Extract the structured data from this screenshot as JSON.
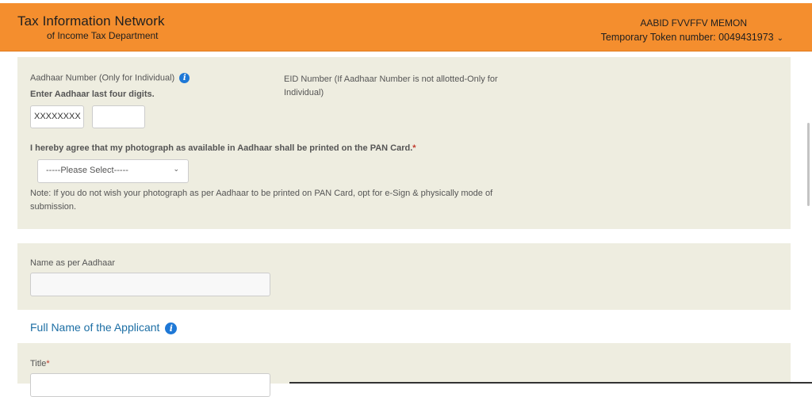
{
  "header": {
    "brand_title": "Tax Information Network",
    "brand_subtitle": "of Income Tax Department",
    "user_name": "AABID FVVFFV MEMON",
    "token_label": "Temporary Token number: 0049431973",
    "accent_color": "#f48e2e"
  },
  "aadhaar": {
    "label": "Aadhaar Number (Only for Individual)",
    "instruction": "Enter Aadhaar last four digits.",
    "masked_value": "XXXXXXXX",
    "last_four_value": "",
    "eid_label": "EID Number (If Aadhaar Number is not allotted-Only for Individual)"
  },
  "photo_consent": {
    "question": "I hereby agree that my photograph as available in Aadhaar shall be printed on the PAN Card.",
    "required_mark": "*",
    "select_value": "-----Please Select-----",
    "note": "Note: If you do not wish your photograph as per Aadhaar to be printed on PAN Card, opt for e-Sign & physically mode of submission."
  },
  "name_as_aadhaar": {
    "label": "Name as per Aadhaar",
    "value": ""
  },
  "applicant": {
    "section_title": "Full Name of the Applicant",
    "title_label": "Title",
    "required_mark": "*"
  },
  "icons": {
    "info": "info-icon",
    "chevron": "chevron-down-icon"
  }
}
